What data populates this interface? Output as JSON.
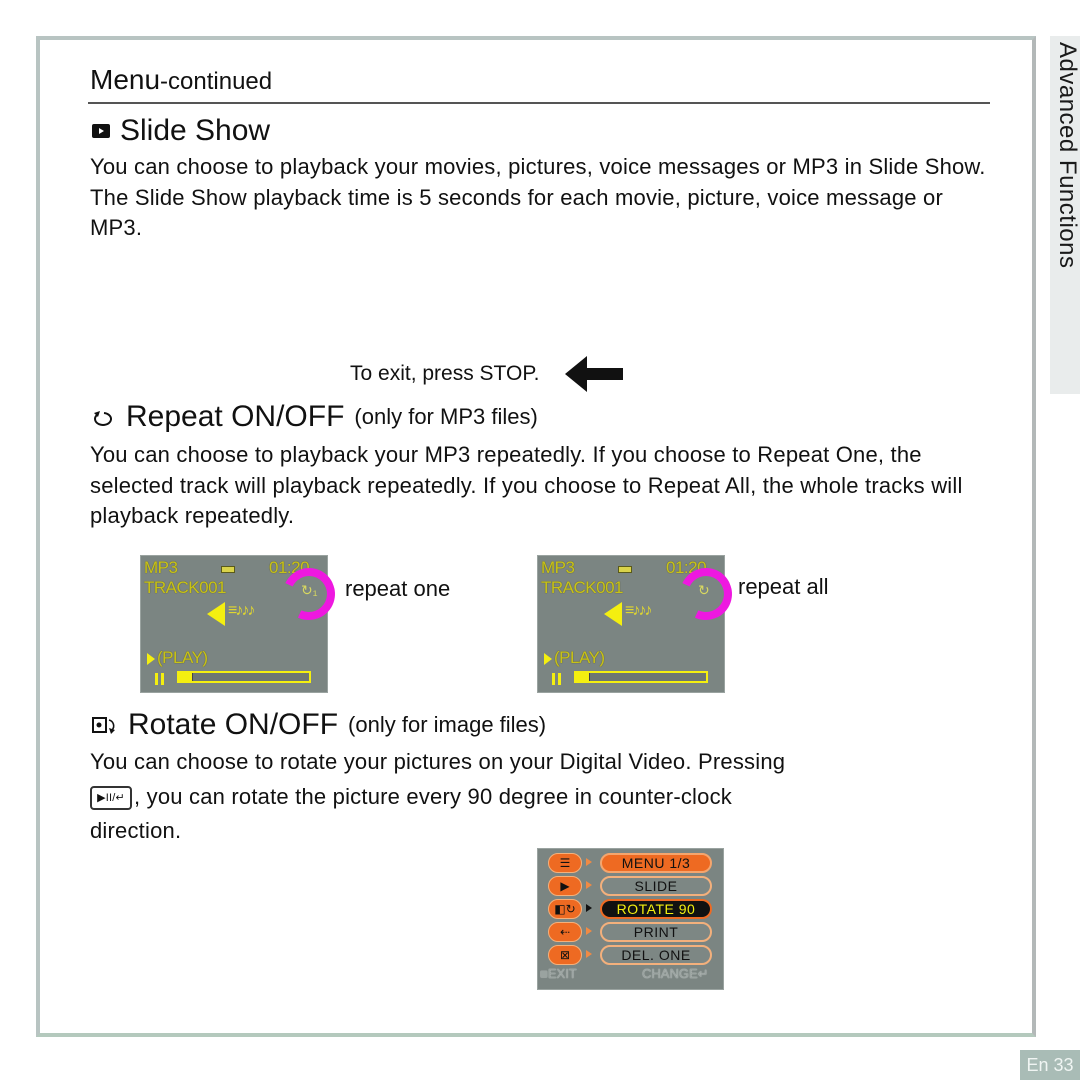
{
  "side_tab": {
    "label": "Advanced Functions"
  },
  "page_number": "En 33",
  "header": {
    "title_main": "Menu",
    "title_suffix": "-continued"
  },
  "slide_show": {
    "icon": "slide-play-icon",
    "title": "Slide Show",
    "body": "You can choose to playback your movies, pictures, voice messages or MP3 in Slide Show. The Slide Show playback time is 5 seconds for each movie, picture, voice message or MP3.",
    "exit_note": "To exit, press STOP.",
    "exit_arrow_icon": "arrow-left-icon"
  },
  "repeat": {
    "icon": "repeat-icon",
    "title": "Repeat ON/OFF",
    "note": "(only for MP3 files)",
    "body": "You can choose to playback your MP3 repeatedly. If you choose to Repeat One, the selected track will playback repeatedly. If you choose to Repeat All, the whole tracks will playback repeatedly.",
    "screens": [
      {
        "mode": "MP3",
        "time": "01:20",
        "track": "TRACK001",
        "status": "(PLAY)",
        "repeat_glyph": "↻₁",
        "label": "repeat one",
        "progress": 0.1
      },
      {
        "mode": "MP3",
        "time": "01:20",
        "track": "TRACK001",
        "status": "(PLAY)",
        "repeat_glyph": "↻",
        "label": "repeat all",
        "progress": 0.1
      }
    ]
  },
  "rotate": {
    "icon": "rotate-icon",
    "title": "Rotate ON/OFF",
    "note": "(only for image files)",
    "body_1": "You can choose to rotate your pictures on your Digital Video. Pressing",
    "key_label": "▶II/↵",
    "body_2": ", you can rotate the picture every 90 degree in counter-clock",
    "body_3": "direction.",
    "menu_screen": {
      "rows": [
        {
          "icon": "☰",
          "label": "MENU  1/3",
          "kind": "head"
        },
        {
          "icon": "▶",
          "label": "SLIDE",
          "kind": "normal"
        },
        {
          "icon": "◧↻",
          "label": "ROTATE  90",
          "kind": "selected"
        },
        {
          "icon": "⇠",
          "label": "PRINT",
          "kind": "normal"
        },
        {
          "icon": "⊠",
          "label": "DEL.  ONE",
          "kind": "normal"
        }
      ],
      "exit_label": "■EXIT",
      "change_label": "CHANGE↵"
    }
  }
}
